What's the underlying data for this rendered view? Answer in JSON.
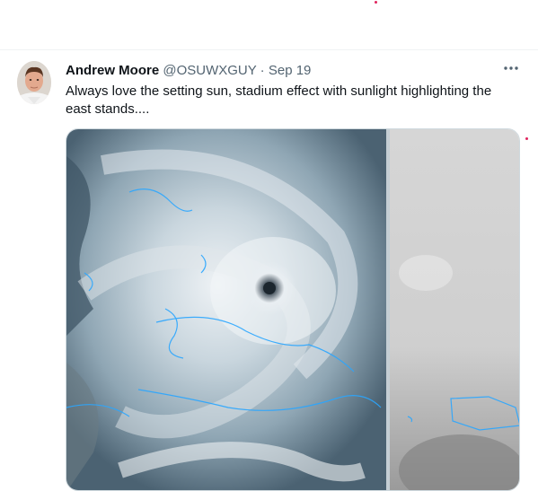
{
  "tweet": {
    "author_name": "Andrew Moore",
    "handle": "@OSUWXGUY",
    "separator": "·",
    "date": "Sep 19",
    "text": "Always love the setting sun, stadium effect with sunlight highlighting the east stands....",
    "more_icon": "more-horizontal-icon",
    "media_subject": "satellite image of hurricane"
  },
  "colors": {
    "text_primary": "#0f1419",
    "text_secondary": "#536471",
    "divider": "#eff3f4",
    "coastline": "#2aa6ff"
  }
}
